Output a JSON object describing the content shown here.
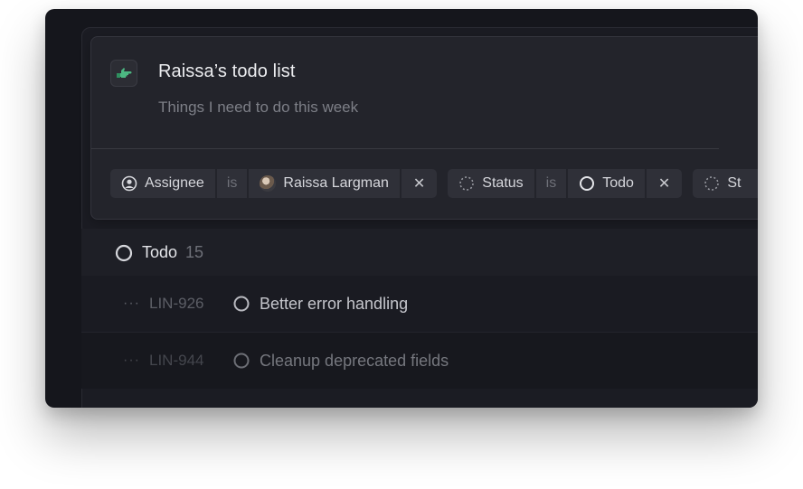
{
  "list": {
    "emoji_icon": "pointing-hand-icon",
    "title": "Raissa’s todo list",
    "subtitle": "Things I need to do this week"
  },
  "filters": [
    {
      "field_icon": "user-circle-icon",
      "field": "Assignee",
      "operator": "is",
      "value_icon": "avatar",
      "value": "Raissa Largman",
      "remove": "✕"
    },
    {
      "field_icon": "status-dashed-icon",
      "field": "Status",
      "operator": "is",
      "value_icon": "circle-outline-icon",
      "value": "Todo",
      "remove": "✕"
    },
    {
      "field_icon": "status-dashed-icon",
      "field": "St"
    }
  ],
  "group": {
    "icon": "circle-outline-icon",
    "name": "Todo",
    "count": "15"
  },
  "issues": [
    {
      "dots": "···",
      "id": "LIN-926",
      "status_icon": "circle-outline-icon",
      "title": "Better error handling"
    },
    {
      "dots": "···",
      "id": "LIN-944",
      "status_icon": "circle-outline-icon",
      "title": "Cleanup deprecated fields"
    }
  ],
  "colors": {
    "background": "#15161c",
    "card": "#23242b",
    "chip": "#2f3038",
    "accent_green": "#4cb782"
  }
}
